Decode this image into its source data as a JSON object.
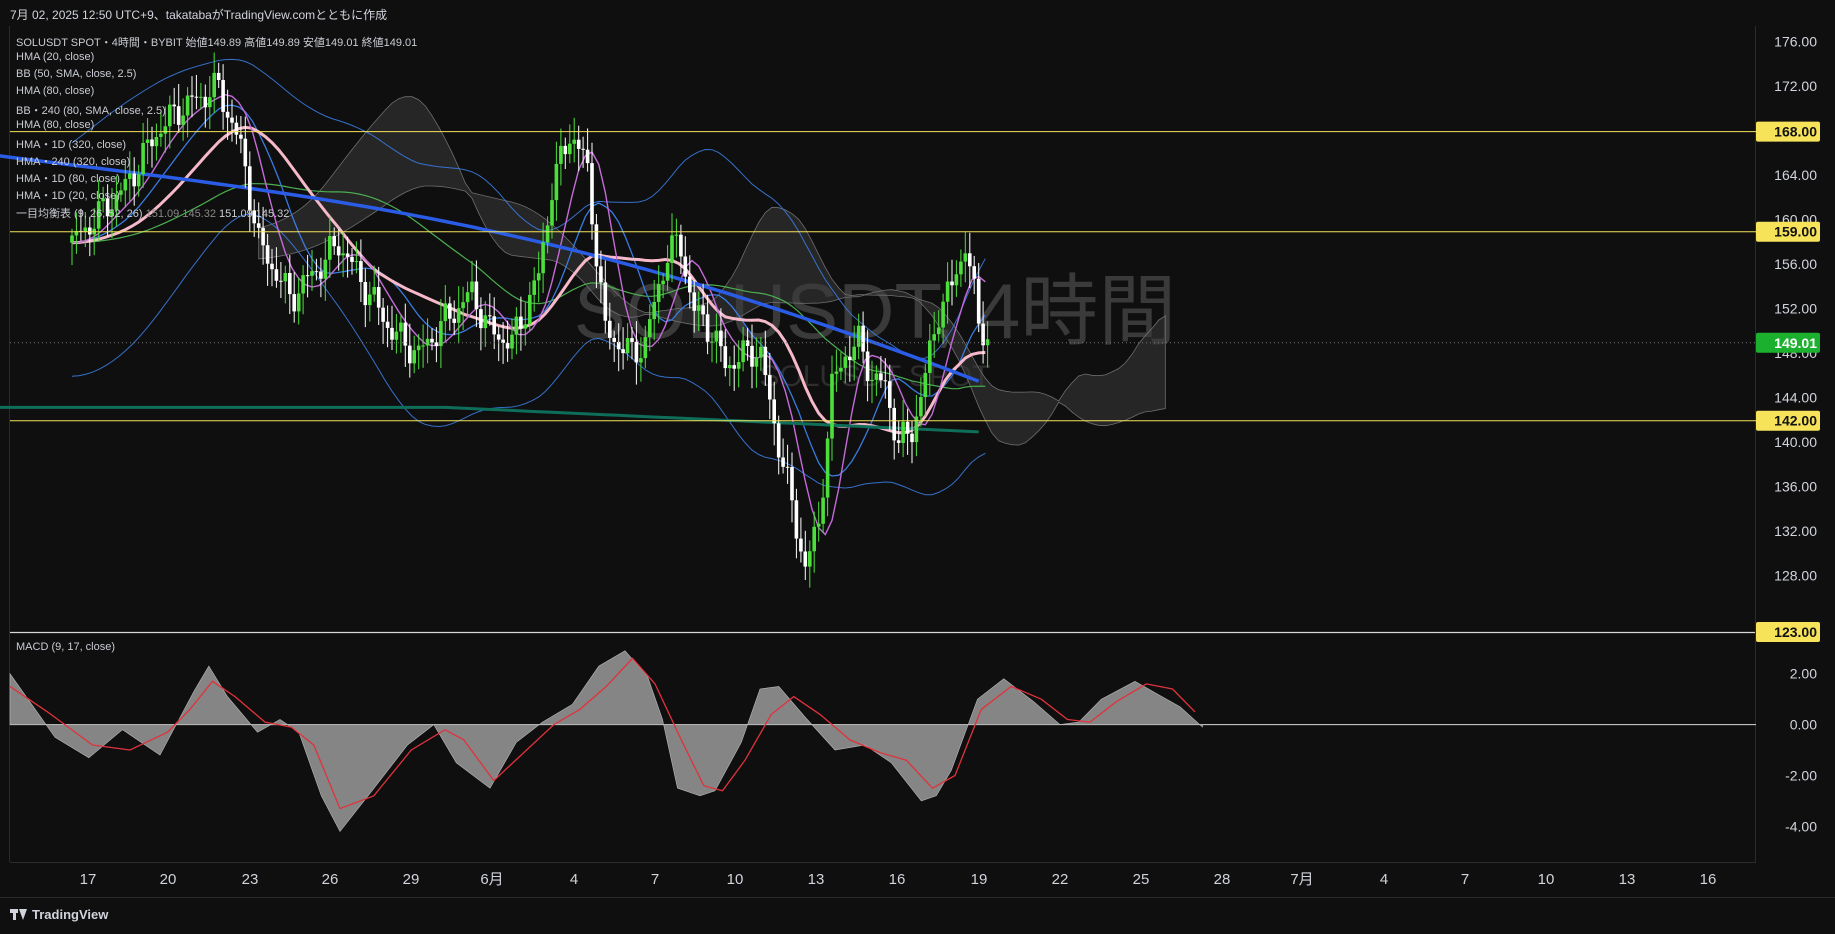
{
  "header": {
    "caption": "7月 02, 2025 12:50 UTC+9、takatabaがTradingView.comとともに作成"
  },
  "legend": {
    "symbol_line": "SOLUSDT SPOT・4時間・BYBIT  始値149.89  高値149.89  安値149.01  終値149.01",
    "lines": [
      "HMA (20, close)",
      "BB (50, SMA, close, 2.5)",
      "HMA (80, close)",
      "BB・240 (80, SMA, close, 2.5)",
      "HMA (80, close)",
      "HMA・1D (320, close)",
      "HMA・240 (320, close)",
      "HMA・1D (80, close)",
      "HMA・1D (20, close)"
    ],
    "ichimoku_label": "一目均衡表 (9, 26, 52, 26)",
    "ichimoku_values": [
      "151.09",
      "145.32",
      "151.09",
      "145.32"
    ]
  },
  "watermark": {
    "title": "SOLUSDT, 4時間",
    "subtitle": "SOLUSDT SPOT"
  },
  "macd_legend": "MACD (9, 17, close)",
  "footer": {
    "logo": "TradingView"
  },
  "colors": {
    "background": "#0f0f0f",
    "bull": "#4cdf3c",
    "bear": "#ffffff",
    "hma_pink": "#f6b9c9",
    "hma_violet": "#c46bd8",
    "hma_blue_thick": "#2a5ce6",
    "bb_blue": "#3a7be0",
    "hma_green": "#4caf50",
    "hma_teal": "#0f6e5a",
    "level_line": "#f6e35a",
    "macd_signal": "#e0323c",
    "macd_hist": "#9a9a9a"
  },
  "chart_data": [
    {
      "type": "candlestick",
      "title": "SOLUSDT, 4時間",
      "x_ticks": [
        "17",
        "20",
        "23",
        "26",
        "29",
        "6月",
        "4",
        "7",
        "10",
        "13",
        "16",
        "19",
        "22",
        "25",
        "28",
        "7月",
        "4",
        "7",
        "10",
        "13",
        "16"
      ],
      "y_ticks": [
        176.0,
        172.0,
        168.0,
        164.0,
        160.0,
        156.0,
        152.0,
        148.0,
        144.0,
        140.0,
        136.0,
        132.0,
        128.0
      ],
      "ylim": [
        123.0,
        177.5
      ],
      "last_price": 149.01,
      "price_labels": [
        168.0,
        159.0,
        149.01,
        142.0,
        123.0
      ],
      "horizontal_levels": [
        168.0,
        159.0,
        142.0
      ],
      "price_path": [
        [
          0,
          158
        ],
        [
          2,
          163
        ],
        [
          3.2,
          168
        ],
        [
          4,
          170
        ],
        [
          5.5,
          172
        ],
        [
          6.4,
          166
        ],
        [
          7,
          158
        ],
        [
          8.2,
          153
        ],
        [
          9.5,
          156.5
        ],
        [
          10,
          158
        ],
        [
          11,
          154
        ],
        [
          12,
          150
        ],
        [
          13,
          148
        ],
        [
          14,
          151
        ],
        [
          15,
          153.5
        ],
        [
          15.7,
          150
        ],
        [
          16.5,
          149
        ],
        [
          17.5,
          155
        ],
        [
          18,
          163
        ],
        [
          18.7,
          168
        ],
        [
          19.3,
          165
        ],
        [
          20,
          150
        ],
        [
          21,
          148
        ],
        [
          21.5,
          149
        ],
        [
          22.3,
          157
        ],
        [
          22.8,
          158
        ],
        [
          23.3,
          152
        ],
        [
          24,
          150
        ],
        [
          24.5,
          147
        ],
        [
          25.3,
          148
        ],
        [
          25.8,
          148.5
        ],
        [
          26.2,
          143
        ],
        [
          26.7,
          138
        ],
        [
          27.1,
          133
        ],
        [
          27.5,
          129
        ],
        [
          28,
          132.5
        ],
        [
          28.5,
          145
        ],
        [
          29,
          148
        ],
        [
          29.5,
          149
        ],
        [
          30,
          146
        ],
        [
          30.5,
          145
        ],
        [
          31,
          140
        ],
        [
          31.5,
          141
        ],
        [
          32,
          146
        ],
        [
          32.5,
          152
        ],
        [
          33,
          154
        ],
        [
          33.5,
          158
        ],
        [
          33.7,
          155
        ],
        [
          34,
          151
        ],
        [
          34.4,
          149
        ]
      ],
      "series_names": [],
      "indicators_note": ""
    },
    {
      "type": "line",
      "title": "MACD (9, 17, close)",
      "y_ticks": [
        2.0,
        0.0,
        -2.0,
        -4.0
      ],
      "ylim": [
        -5.4,
        3.6
      ],
      "macd_path": [
        [
          0,
          2.0
        ],
        [
          1.2,
          -0.5
        ],
        [
          2.1,
          -1.3
        ],
        [
          3.0,
          -0.2
        ],
        [
          4.0,
          -1.2
        ],
        [
          4.9,
          1.3
        ],
        [
          5.3,
          2.3
        ],
        [
          5.8,
          1.1
        ],
        [
          6.6,
          -0.3
        ],
        [
          7.2,
          0.2
        ],
        [
          7.7,
          -0.3
        ],
        [
          8.3,
          -2.8
        ],
        [
          8.8,
          -4.2
        ],
        [
          9.6,
          -2.7
        ],
        [
          10.6,
          -0.8
        ],
        [
          11.3,
          0.0
        ],
        [
          11.9,
          -1.5
        ],
        [
          12.8,
          -2.5
        ],
        [
          13.5,
          -0.7
        ],
        [
          14.2,
          0.1
        ],
        [
          15.0,
          0.8
        ],
        [
          15.7,
          2.3
        ],
        [
          16.4,
          2.9
        ],
        [
          17.0,
          1.9
        ],
        [
          17.4,
          0.2
        ],
        [
          17.8,
          -2.5
        ],
        [
          18.4,
          -2.8
        ],
        [
          18.8,
          -2.6
        ],
        [
          19.5,
          -0.7
        ],
        [
          20.0,
          1.4
        ],
        [
          20.5,
          1.5
        ],
        [
          21.2,
          0.3
        ],
        [
          22.0,
          -1.0
        ],
        [
          22.8,
          -0.8
        ],
        [
          23.5,
          -1.5
        ],
        [
          24.3,
          -3.0
        ],
        [
          24.7,
          -2.8
        ],
        [
          25.1,
          -1.8
        ],
        [
          25.8,
          1.0
        ],
        [
          26.5,
          1.8
        ],
        [
          27.3,
          0.9
        ],
        [
          28.0,
          0.0
        ],
        [
          28.5,
          0.1
        ],
        [
          29.1,
          1.0
        ],
        [
          30.0,
          1.7
        ],
        [
          30.6,
          1.2
        ],
        [
          31.2,
          0.7
        ],
        [
          31.8,
          -0.1
        ]
      ],
      "signal_path": [
        [
          0,
          1.5
        ],
        [
          1.0,
          0.5
        ],
        [
          2.2,
          -0.8
        ],
        [
          3.2,
          -1.0
        ],
        [
          4.2,
          -0.3
        ],
        [
          4.8,
          0.6
        ],
        [
          5.4,
          1.7
        ],
        [
          6.0,
          1.1
        ],
        [
          6.8,
          0.1
        ],
        [
          7.5,
          -0.1
        ],
        [
          8.1,
          -0.8
        ],
        [
          8.8,
          -3.3
        ],
        [
          9.7,
          -2.8
        ],
        [
          10.7,
          -1.0
        ],
        [
          11.6,
          -0.2
        ],
        [
          12.1,
          -0.6
        ],
        [
          12.9,
          -2.2
        ],
        [
          13.7,
          -1.1
        ],
        [
          14.5,
          0.0
        ],
        [
          15.2,
          0.6
        ],
        [
          15.9,
          1.5
        ],
        [
          16.6,
          2.6
        ],
        [
          17.2,
          1.6
        ],
        [
          17.9,
          -0.6
        ],
        [
          18.5,
          -2.4
        ],
        [
          19.0,
          -2.6
        ],
        [
          19.6,
          -1.4
        ],
        [
          20.3,
          0.4
        ],
        [
          20.9,
          1.1
        ],
        [
          21.6,
          0.4
        ],
        [
          22.4,
          -0.6
        ],
        [
          23.2,
          -1.1
        ],
        [
          23.9,
          -1.4
        ],
        [
          24.6,
          -2.5
        ],
        [
          25.2,
          -2.0
        ],
        [
          25.9,
          0.6
        ],
        [
          26.7,
          1.5
        ],
        [
          27.5,
          1.0
        ],
        [
          28.2,
          0.2
        ],
        [
          28.8,
          0.1
        ],
        [
          29.5,
          0.9
        ],
        [
          30.3,
          1.6
        ],
        [
          31.0,
          1.4
        ],
        [
          31.6,
          0.5
        ]
      ]
    }
  ]
}
